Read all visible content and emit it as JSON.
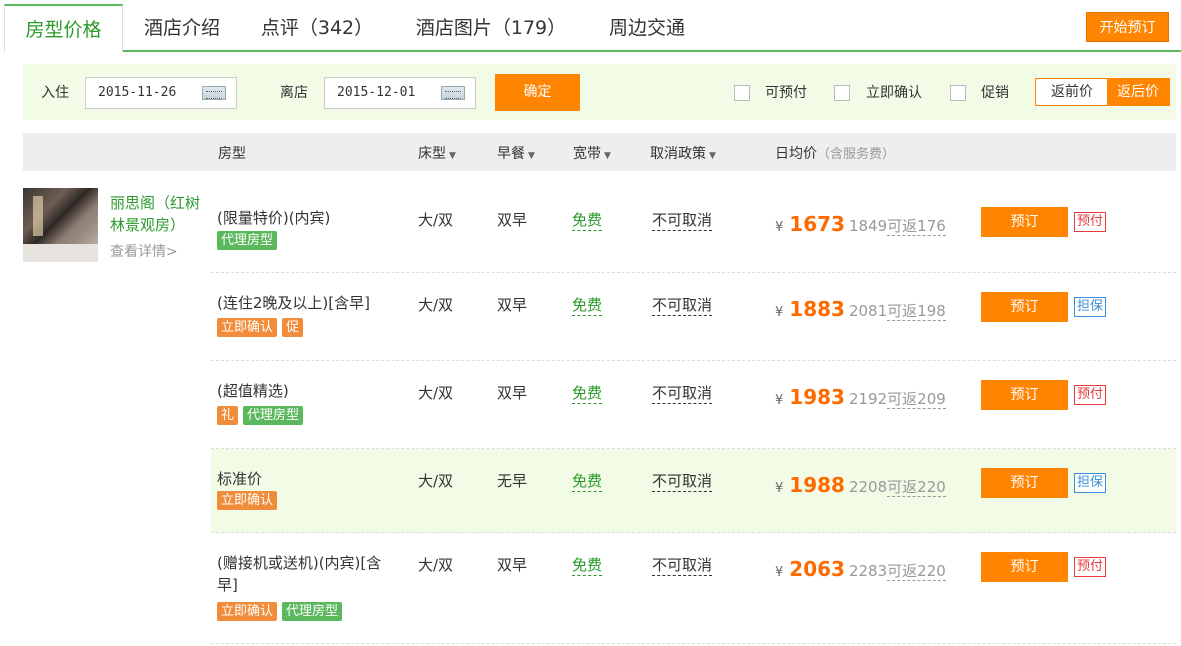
{
  "tabs": [
    {
      "label": "房型价格",
      "count": ""
    },
    {
      "label": "酒店介绍",
      "count": ""
    },
    {
      "label": "点评",
      "count": "342"
    },
    {
      "label": "酒店图片",
      "count": "179"
    },
    {
      "label": "周边交通",
      "count": ""
    }
  ],
  "book_now_label": "开始预订",
  "filter": {
    "checkin_label": "入住",
    "checkin_value": "2015-11-26",
    "checkout_label": "离店",
    "checkout_value": "2015-12-01",
    "confirm_label": "确定",
    "options": [
      "可预付",
      "立即确认",
      "促销"
    ],
    "toggle": [
      "返前价",
      "返后价"
    ]
  },
  "columns": {
    "room": "房型",
    "bed": "床型",
    "breakfast": "早餐",
    "broadband": "宽带",
    "cancel": "取消政策",
    "price": "日均价",
    "price_note": "（含服务费）"
  },
  "hotel_room": {
    "name": "丽思阁（红树林景观房）",
    "detail": "查看详情>"
  },
  "rows": [
    {
      "name": "(限量特价)(内宾)",
      "tags": [
        {
          "text": "代理房型",
          "color": "green"
        }
      ],
      "bed": "大/双",
      "breakfast": "双早",
      "broadband": "免费",
      "cancel": "不可取消",
      "currency": "¥",
      "price": "1673",
      "original": "1849",
      "cashback_label": "可返",
      "cashback": "176",
      "book": "预订",
      "badge": "预付",
      "badge_color": "red"
    },
    {
      "name": "(连住2晚及以上)[含早]",
      "tags": [
        {
          "text": "立即确认",
          "color": "orange"
        },
        {
          "text": "促",
          "color": "orange"
        }
      ],
      "bed": "大/双",
      "breakfast": "双早",
      "broadband": "免费",
      "cancel": "不可取消",
      "currency": "¥",
      "price": "1883",
      "original": "2081",
      "cashback_label": "可返",
      "cashback": "198",
      "book": "预订",
      "badge": "担保",
      "badge_color": "blue"
    },
    {
      "name": "(超值精选)",
      "tags": [
        {
          "text": "礼",
          "color": "orange"
        },
        {
          "text": "代理房型",
          "color": "green"
        }
      ],
      "bed": "大/双",
      "breakfast": "双早",
      "broadband": "免费",
      "cancel": "不可取消",
      "currency": "¥",
      "price": "1983",
      "original": "2192",
      "cashback_label": "可返",
      "cashback": "209",
      "book": "预订",
      "badge": "预付",
      "badge_color": "red"
    },
    {
      "name": "标准价",
      "tags": [
        {
          "text": "立即确认",
          "color": "orange"
        }
      ],
      "bed": "大/双",
      "breakfast": "无早",
      "broadband": "免费",
      "cancel": "不可取消",
      "currency": "¥",
      "price": "1988",
      "original": "2208",
      "cashback_label": "可返",
      "cashback": "220",
      "book": "预订",
      "badge": "担保",
      "badge_color": "blue"
    },
    {
      "name": "(赠接机或送机)(内宾)[含早]",
      "tags": [
        {
          "text": "立即确认",
          "color": "orange"
        },
        {
          "text": "代理房型",
          "color": "green"
        }
      ],
      "bed": "大/双",
      "breakfast": "双早",
      "broadband": "免费",
      "cancel": "不可取消",
      "currency": "¥",
      "price": "2063",
      "original": "2283",
      "cashback_label": "可返",
      "cashback": "220",
      "book": "预订",
      "badge": "预付",
      "badge_color": "red"
    }
  ]
}
